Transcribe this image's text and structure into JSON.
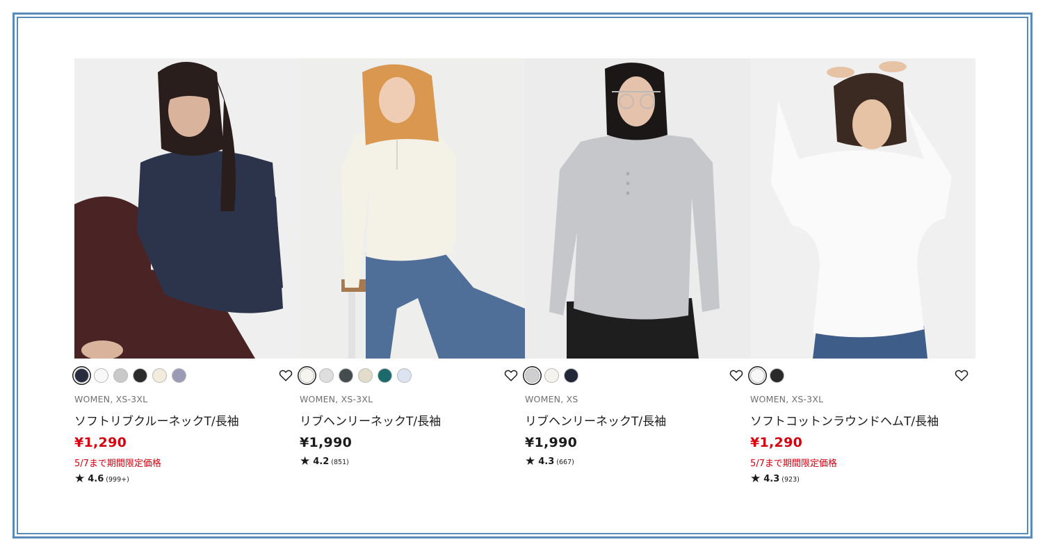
{
  "products": [
    {
      "category": "WOMEN, XS-3XL",
      "name": "ソフトリブクルーネックT/長袖",
      "price": "¥1,290",
      "sale": true,
      "promo": "5/7まで期間限定価格",
      "rating": {
        "star": "★",
        "score": "4.6",
        "count": "(999+)"
      },
      "swatches": [
        "#282c3e",
        "#f8f8fa",
        "#c9c9c9",
        "#2b2b2b",
        "#f3ecdd",
        "#9b9bb5"
      ],
      "selected_swatch": 0,
      "shirt_color": "#2c344c",
      "pants_color": "#4a2324"
    },
    {
      "category": "WOMEN, XS-3XL",
      "name": "リブヘンリーネックT/長袖",
      "price": "¥1,990",
      "sale": false,
      "promo": "",
      "rating": {
        "star": "★",
        "score": "4.2",
        "count": "(851)"
      },
      "swatches": [
        "#f5f4ee",
        "#dedede",
        "#454c4e",
        "#e4dccb",
        "#1c6a6d",
        "#dbe4f0"
      ],
      "selected_swatch": 0,
      "shirt_color": "#f4f1e6",
      "pants_color": "#4f6f98"
    },
    {
      "category": "WOMEN, XS",
      "name": "リブヘンリーネックT/長袖",
      "price": "¥1,990",
      "sale": false,
      "promo": "",
      "rating": {
        "star": "★",
        "score": "4.3",
        "count": "(667)"
      },
      "swatches": [
        "#cfcfd1",
        "#f4f3ee",
        "#232839"
      ],
      "selected_swatch": 0,
      "shirt_color": "#c6c7ca",
      "pants_color": "#1e1e1f"
    },
    {
      "category": "WOMEN, XS-3XL",
      "name": "ソフトコットンラウンドヘムT/長袖",
      "price": "¥1,290",
      "sale": true,
      "promo": "5/7まで期間限定価格",
      "rating": {
        "star": "★",
        "score": "4.3",
        "count": "(923)"
      },
      "swatches": [
        "#f7f7f7",
        "#2a2a2a"
      ],
      "selected_swatch": 0,
      "shirt_color": "#fafafa",
      "pants_color": "#3f5d89"
    }
  ],
  "icons": {
    "favorite": "heart-outline-icon",
    "rating": "star-icon"
  }
}
